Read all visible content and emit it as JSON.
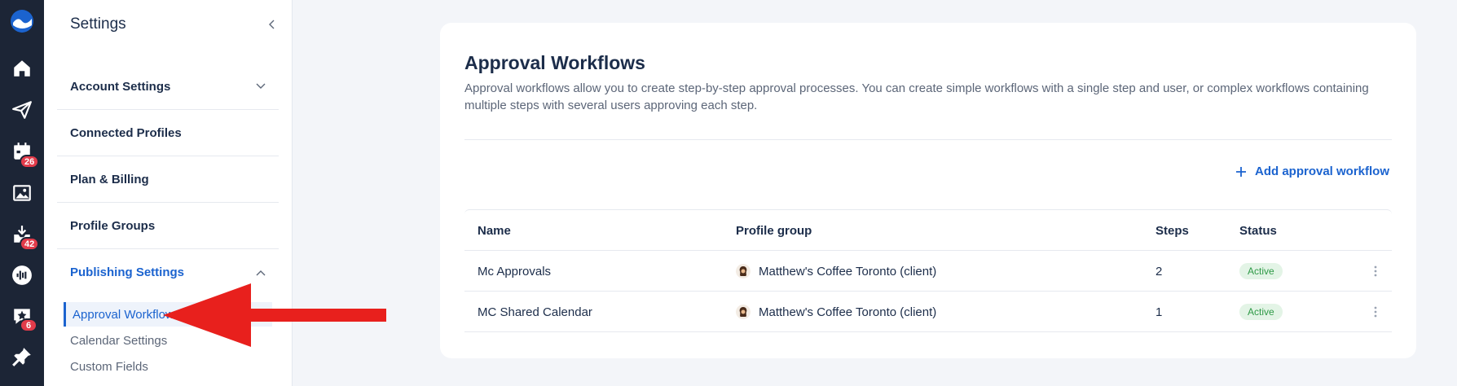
{
  "rail": {
    "badges": {
      "calendar": "26",
      "inbox": "42",
      "reviews": "6"
    }
  },
  "sidebar": {
    "title": "Settings",
    "items": [
      {
        "label": "Account Settings"
      },
      {
        "label": "Connected Profiles"
      },
      {
        "label": "Plan & Billing"
      },
      {
        "label": "Profile Groups"
      },
      {
        "label": "Publishing Settings"
      }
    ],
    "subitems": [
      {
        "label": "Approval Workflows"
      },
      {
        "label": "Calendar Settings"
      },
      {
        "label": "Custom Fields"
      }
    ]
  },
  "main": {
    "title": "Approval Workflows",
    "description": "Approval workflows allow you to create step-by-step approval processes. You can create simple workflows with a single step and user, or complex workflows containing multiple steps with several users approving each step.",
    "add_label": "Add approval workflow",
    "table": {
      "headers": {
        "name": "Name",
        "group": "Profile group",
        "steps": "Steps",
        "status": "Status"
      },
      "rows": [
        {
          "name": "Mc Approvals",
          "group": "Matthew's Coffee Toronto (client)",
          "steps": "2",
          "status": "Active"
        },
        {
          "name": "MC Shared Calendar",
          "group": "Matthew's Coffee Toronto (client)",
          "steps": "1",
          "status": "Active"
        }
      ]
    }
  },
  "colors": {
    "accent": "#1b63cf",
    "rail": "#1c2536",
    "badge": "#e23b4a",
    "active_pill": "#2f9a47",
    "arrow": "#e8201d"
  }
}
